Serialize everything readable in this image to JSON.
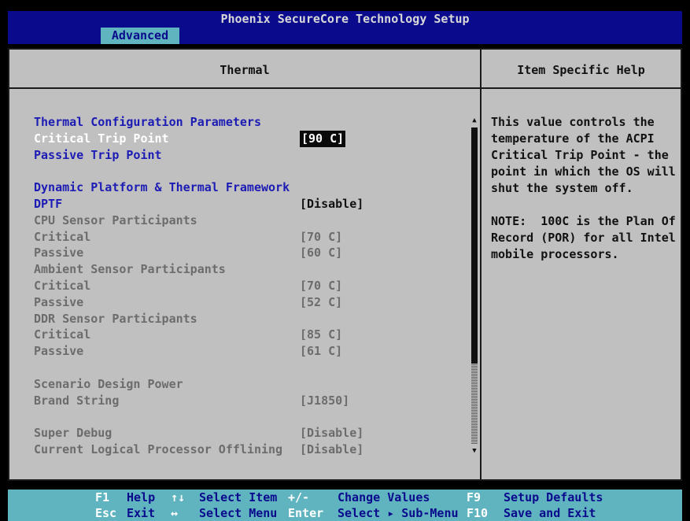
{
  "title": "Phoenix SecureCore Technology Setup",
  "menu": {
    "active_tab": "Advanced"
  },
  "panel": {
    "left_header": "Thermal",
    "right_header": "Item Specific Help"
  },
  "settings": [
    {
      "label": "Thermal Configuration Parameters",
      "value": "",
      "style": "blue"
    },
    {
      "label": "Critical Trip Point",
      "value": "[90 C]",
      "style": "white",
      "selected": true
    },
    {
      "label": "Passive Trip Point",
      "value": "",
      "style": "blue"
    },
    {
      "label": "",
      "value": "",
      "style": "gray"
    },
    {
      "label": "Dynamic Platform & Thermal Framework",
      "value": "",
      "style": "blue"
    },
    {
      "label": "DPTF",
      "value": "[Disable]",
      "style": "blue",
      "value_style": "dark"
    },
    {
      "label": "CPU Sensor Participants",
      "value": "",
      "style": "gray"
    },
    {
      "label": "Critical",
      "value": "[70 C]",
      "style": "gray"
    },
    {
      "label": "Passive",
      "value": "[60 C]",
      "style": "gray"
    },
    {
      "label": "Ambient Sensor Participants",
      "value": "",
      "style": "gray"
    },
    {
      "label": "Critical",
      "value": "[70 C]",
      "style": "gray"
    },
    {
      "label": "Passive",
      "value": "[52 C]",
      "style": "gray"
    },
    {
      "label": "DDR Sensor Participants",
      "value": "",
      "style": "gray"
    },
    {
      "label": "Critical",
      "value": "[85 C]",
      "style": "gray"
    },
    {
      "label": "Passive",
      "value": "[61 C]",
      "style": "gray"
    },
    {
      "label": "",
      "value": "",
      "style": "gray"
    },
    {
      "label": "Scenario Design Power",
      "value": "",
      "style": "gray"
    },
    {
      "label": "Brand String",
      "value": "[J1850]",
      "style": "gray"
    },
    {
      "label": "",
      "value": "",
      "style": "gray"
    },
    {
      "label": "Super Debug",
      "value": "[Disable]",
      "style": "gray"
    },
    {
      "label": "Current Logical Processor Offlining",
      "value": "[Disable]",
      "style": "gray"
    }
  ],
  "help": {
    "text": "This value controls the\ntemperature of the ACPI\nCritical Trip Point - the\npoint in which the OS will\nshut the system off.\n\nNOTE:  100C is the Plan Of\nRecord (POR) for all Intel\nmobile processors."
  },
  "status": {
    "f1_key": "F1",
    "f1_desc": "Help",
    "arrows_ud": "↑↓",
    "arrows_ud_desc": "Select Item",
    "pm_key": "+/-",
    "pm_desc": "Change Values",
    "f9_key": "F9",
    "f9_desc": "Setup Defaults",
    "esc_key": "Esc",
    "esc_desc": "Exit",
    "arrows_lr": "↔",
    "arrows_lr_desc": "Select Menu",
    "enter_key": "Enter",
    "enter_desc": "Select ▸ Sub-Menu",
    "f10_key": "F10",
    "f10_desc": "Save and Exit"
  },
  "icons": {
    "scroll_up": "scroll-up-arrow-icon",
    "scroll_down": "scroll-down-arrow-icon"
  },
  "colors": {
    "title_bg": "#0a0a8c",
    "panel_bg": "#c0c0c0",
    "status_bg": "#5fb4c0",
    "section_blue": "#1c1cb4"
  }
}
